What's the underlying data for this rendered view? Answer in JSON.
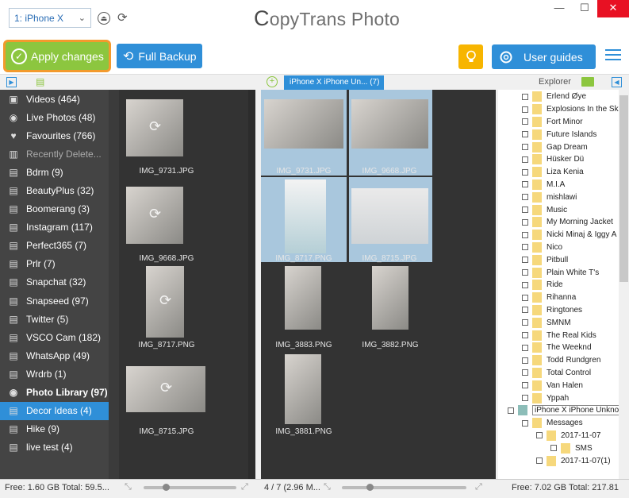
{
  "window": {
    "title_prefix": "C",
    "title_rest": "opyTrans Photo",
    "minimize": "—",
    "maximize": "☐",
    "close": "✕"
  },
  "device_select": {
    "value": "1: iPhone X"
  },
  "toolbar": {
    "apply_label": "Apply changes",
    "backup_label": "Full Backup",
    "guides_label": "User guides"
  },
  "middle_tab": {
    "label": "iPhone X iPhone Un...",
    "count": "(7)"
  },
  "explorer": {
    "label": "Explorer"
  },
  "sidebar": {
    "items": [
      {
        "label": "Videos (464)",
        "icon": "video-icon"
      },
      {
        "label": "Live Photos (48)",
        "icon": "camera-icon"
      },
      {
        "label": "Favourites (766)",
        "icon": "heart-icon"
      },
      {
        "label": "Recently Delete...",
        "icon": "trash-icon"
      },
      {
        "label": "Bdrm (9)",
        "icon": "album-icon"
      },
      {
        "label": "BeautyPlus (32)",
        "icon": "album-icon"
      },
      {
        "label": "Boomerang (3)",
        "icon": "album-icon"
      },
      {
        "label": "Instagram (117)",
        "icon": "album-icon"
      },
      {
        "label": "Perfect365 (7)",
        "icon": "album-icon"
      },
      {
        "label": "Prlr (7)",
        "icon": "album-icon"
      },
      {
        "label": "Snapchat (32)",
        "icon": "album-icon"
      },
      {
        "label": "Snapseed (97)",
        "icon": "album-icon"
      },
      {
        "label": "Twitter (5)",
        "icon": "album-icon"
      },
      {
        "label": "VSCO Cam (182)",
        "icon": "album-icon"
      },
      {
        "label": "WhatsApp (49)",
        "icon": "album-icon"
      },
      {
        "label": "Wrdrb (1)",
        "icon": "album-icon"
      },
      {
        "label": "Photo Library (97)",
        "icon": "camera-icon"
      },
      {
        "label": "Decor Ideas (4)",
        "icon": "album-icon"
      },
      {
        "label": "Hike (9)",
        "icon": "album-icon"
      },
      {
        "label": "live test (4)",
        "icon": "album-icon"
      }
    ]
  },
  "pane1": {
    "thumbs": [
      {
        "name": "IMG_9731.JPG"
      },
      {
        "name": "IMG_9668.JPG"
      },
      {
        "name": "IMG_8717.PNG"
      },
      {
        "name": "IMG_8715.JPG"
      }
    ]
  },
  "pane2": {
    "thumbs": [
      {
        "name": "IMG_9731.JPG"
      },
      {
        "name": "IMG_9668.JPG"
      },
      {
        "name": "IMG_8717.PNG"
      },
      {
        "name": "IMG_8715.JPG"
      },
      {
        "name": "IMG_3883.PNG"
      },
      {
        "name": "IMG_3882.PNG"
      },
      {
        "name": "IMG_3881.PNG"
      }
    ]
  },
  "tree": {
    "items": [
      {
        "label": "Erlend Øye"
      },
      {
        "label": "Explosions In the Sk"
      },
      {
        "label": "Fort Minor"
      },
      {
        "label": "Future Islands"
      },
      {
        "label": "Gap Dream"
      },
      {
        "label": "Hüsker Dü"
      },
      {
        "label": "Liza Kenia"
      },
      {
        "label": "M.I.A"
      },
      {
        "label": "mishlawi"
      },
      {
        "label": "Music"
      },
      {
        "label": "My Morning Jacket"
      },
      {
        "label": "Nicki Minaj & Iggy A"
      },
      {
        "label": "Nico"
      },
      {
        "label": "Pitbull"
      },
      {
        "label": "Plain White T's"
      },
      {
        "label": "Ride"
      },
      {
        "label": "Rihanna"
      },
      {
        "label": "Ringtones"
      },
      {
        "label": "SMNM"
      },
      {
        "label": "The Real Kids"
      },
      {
        "label": "The Weeknd"
      },
      {
        "label": "Todd Rundgren"
      },
      {
        "label": "Total Control"
      },
      {
        "label": "Van Halen"
      },
      {
        "label": "Yppah"
      },
      {
        "label": "iPhone X iPhone Unknown"
      },
      {
        "label": "Messages"
      },
      {
        "label": "2017-11-07"
      },
      {
        "label": "SMS"
      },
      {
        "label": "2017-11-07(1)"
      }
    ]
  },
  "status": {
    "left": "Free: 1.60 GB Total: 59.5...",
    "middle": "4 / 7 (2.96 M...",
    "right": "Free: 7.02 GB Total: 217.81"
  },
  "colors": {
    "accent": "#2f8fd8",
    "apply_green": "#8cc63f",
    "apply_border": "#f39a2d",
    "bulb": "#f7b500"
  }
}
